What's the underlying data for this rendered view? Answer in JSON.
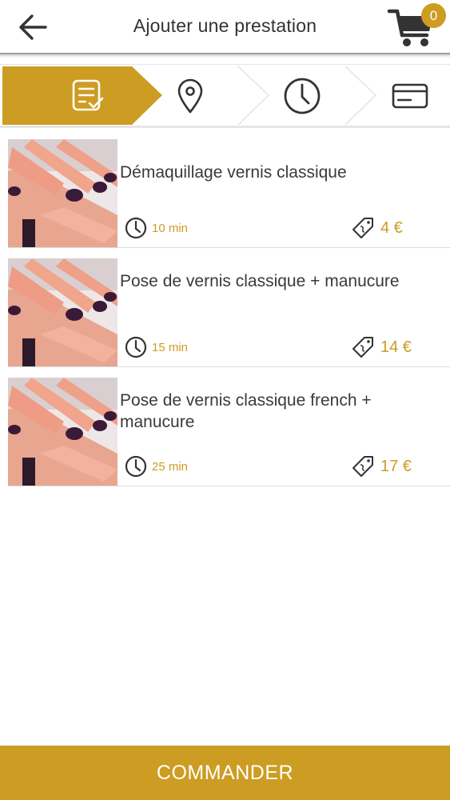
{
  "header": {
    "title": "Ajouter une prestation",
    "cart_count": "0",
    "back_icon": "arrow-left-icon",
    "cart_icon": "shopping-cart-icon"
  },
  "steps": [
    {
      "icon": "checklist-icon",
      "active": true
    },
    {
      "icon": "location-pin-icon",
      "active": false
    },
    {
      "icon": "clock-icon",
      "active": false
    },
    {
      "icon": "credit-card-icon",
      "active": false
    }
  ],
  "services": [
    {
      "title": "Démaquillage vernis classique",
      "duration": "10 min",
      "price": "4 €"
    },
    {
      "title": "Pose de vernis classique + manucure",
      "duration": "15 min",
      "price": "14 €"
    },
    {
      "title": "Pose de vernis classique french + manucure",
      "duration": "25 min",
      "price": "17 €"
    }
  ],
  "footer": {
    "order_label": "COMMANDER"
  },
  "colors": {
    "accent": "#cd9c22",
    "text": "#3a3a3a",
    "divider": "#dcdcdc"
  }
}
